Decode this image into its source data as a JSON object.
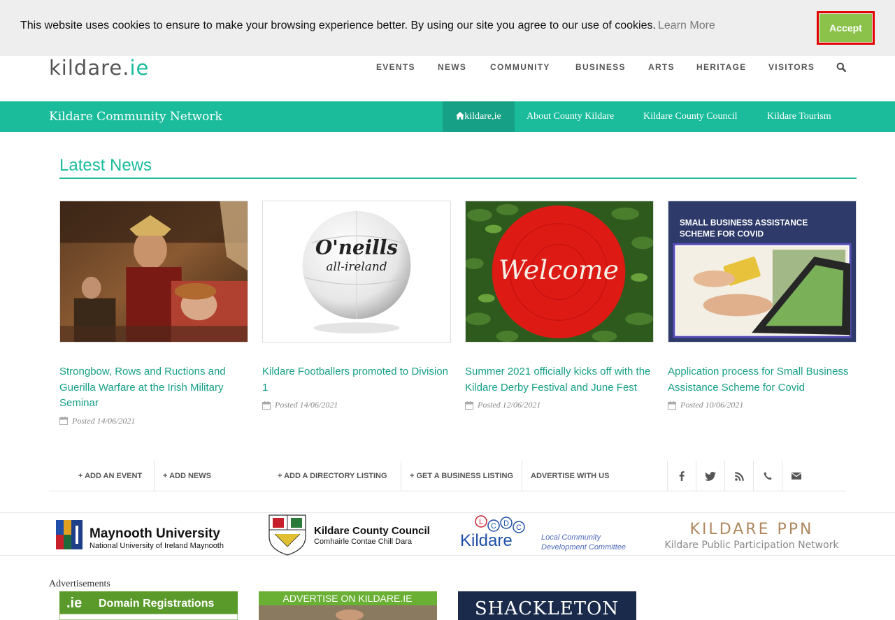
{
  "cookie": {
    "message": "This website uses cookies to ensure to make your browsing experience better. By using our site you agree to our use of cookies.",
    "learn_more": "Learn More",
    "accept": "Accept"
  },
  "header": {
    "logo_main": "kildare.",
    "logo_ie": "ie",
    "nav": [
      "EVENTS",
      "NEWS",
      "COMMUNITY",
      "BUSINESS",
      "ARTS",
      "HERITAGE",
      "VISITORS"
    ]
  },
  "subbar": {
    "title": "Kildare Community Network",
    "home": "kildare,ie",
    "links": [
      "About County Kildare",
      "Kildare County Council",
      "Kildare Tourism"
    ]
  },
  "news": {
    "heading": "Latest News",
    "items": [
      {
        "title": "Strongbow, Rows and Ructions and Guerilla Warfare at the Irish Military Seminar",
        "posted": "Posted 14/06/2021",
        "image": "painting"
      },
      {
        "title": "Kildare Footballers promoted to Division 1",
        "posted": "Posted 14/06/2021",
        "image": "football",
        "ball_text_1": "O'neills",
        "ball_text_2": "all-ireland"
      },
      {
        "title": "Summer 2021 officially kicks off with the Kildare Derby Festival and June Fest",
        "posted": "Posted 12/06/2021",
        "image": "welcome-mat",
        "mat_text": "Welcome"
      },
      {
        "title": "Application process for Small Business Assistance Scheme for Covid",
        "posted": "Posted 10/06/2021",
        "image": "laptop",
        "banner_line1": "SMALL BUSINESS ASSISTANCE",
        "banner_line2": "SCHEME FOR COVID"
      }
    ]
  },
  "actions": [
    "+ ADD AN EVENT",
    "+ ADD NEWS",
    "+ ADD A DIRECTORY LISTING",
    "+ GET A BUSINESS LISTING",
    "ADVERTISE WITH US"
  ],
  "social_icons": [
    "facebook-icon",
    "twitter-icon",
    "rss-icon",
    "phone-icon",
    "email-icon"
  ],
  "partners": {
    "maynooth_1": "Maynooth University",
    "maynooth_2": "National University of Ireland Maynooth",
    "kcc_1": "Kildare County Council",
    "kcc_2": "Comhairle Contae Chill Dara",
    "lcdc_letters": [
      "L",
      "C",
      "D",
      "C"
    ],
    "lcdc_name": "Kildare",
    "lcdc_1": "Local Community",
    "lcdc_2": "Development Committee",
    "ppn_1": "KILDARE PPN",
    "ppn_2": "Kildare Public Participation Network"
  },
  "ads": {
    "label": "Advertisements",
    "domain_ie": ".ie",
    "domain_text": "Domain Registrations",
    "advertise": "ADVERTISE ON KILDARE.IE",
    "shackleton": "SHACKLETON"
  },
  "colors": {
    "brand_green": "#1abc9c",
    "accept_green": "#8bc34a",
    "highlight_red": "#e00000"
  }
}
